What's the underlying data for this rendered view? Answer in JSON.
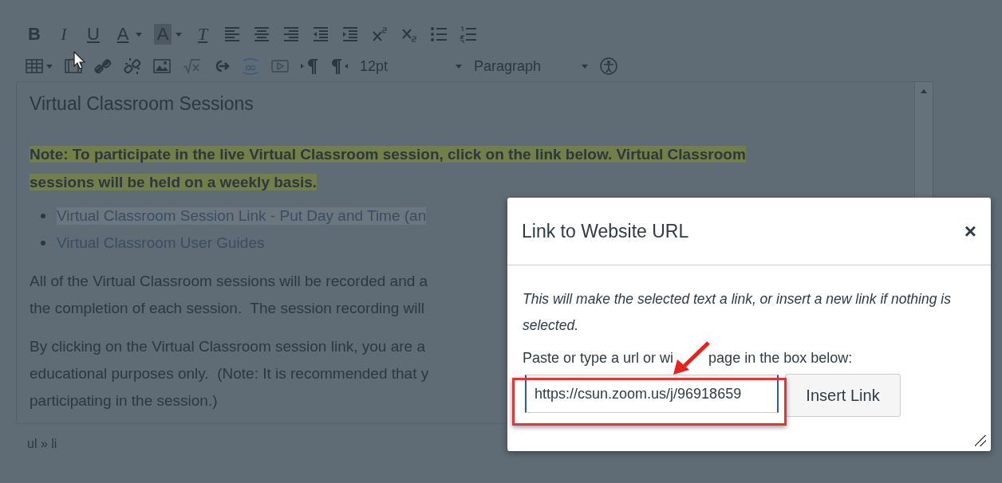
{
  "toolbar": {
    "rows": [
      [
        {
          "kind": "bold",
          "text": "B"
        },
        {
          "kind": "italic",
          "text": "I"
        },
        {
          "kind": "underline",
          "text": "U"
        },
        {
          "kind": "color",
          "text": "A"
        },
        {
          "kind": "highlight",
          "text": "A"
        },
        {
          "kind": "clear",
          "text": "T"
        },
        {
          "kind": "align-left"
        },
        {
          "kind": "align-center"
        },
        {
          "kind": "align-right"
        },
        {
          "kind": "outdent"
        },
        {
          "kind": "indent"
        },
        {
          "kind": "sup"
        },
        {
          "kind": "sub"
        },
        {
          "kind": "bullets"
        },
        {
          "kind": "numbers"
        }
      ],
      [
        {
          "kind": "table"
        },
        {
          "kind": "media"
        },
        {
          "kind": "link"
        },
        {
          "kind": "unlink"
        },
        {
          "kind": "image"
        },
        {
          "kind": "math"
        },
        {
          "kind": "redirect"
        },
        {
          "kind": "box"
        },
        {
          "kind": "video"
        },
        {
          "kind": "ltr"
        },
        {
          "kind": "rtl"
        },
        {
          "kind": "select",
          "text": "12pt"
        },
        {
          "kind": "select",
          "text": "Paragraph"
        },
        {
          "kind": "a11y"
        }
      ]
    ]
  },
  "editor": {
    "heading": "Virtual Classroom Sessions",
    "note": [
      "Note: To participate in the live Virtual Classroom session, click on the link below. Virtual Classroom",
      "sessions will be held on a weekly basis."
    ],
    "list": [
      {
        "text": "Virtual Classroom Session Link - Put Day and Time (an",
        "selected": true
      },
      {
        "text": "Virtual Classroom User Guides",
        "selected": false
      }
    ],
    "paragraphs": [
      [
        "All of the Virtual Classroom sessions will be recorded and a",
        "the completion of each session.  The session recording will"
      ],
      [
        "By clicking on the Virtual Classroom session link, you are a",
        "educational purposes only.  (Note: It is recommended that y",
        "participating in the session.)"
      ]
    ]
  },
  "status_bar": {
    "path": "ul » li"
  },
  "dialog": {
    "title": "Link to Website URL",
    "close": "×",
    "description": "This will make the selected text a link, or insert a new link if nothing is selected.",
    "prompt": [
      "Paste or type a url or wi",
      "page in the box below:"
    ],
    "url": "https://csun.zoom.us/j/96918659",
    "button": "Insert Link"
  }
}
